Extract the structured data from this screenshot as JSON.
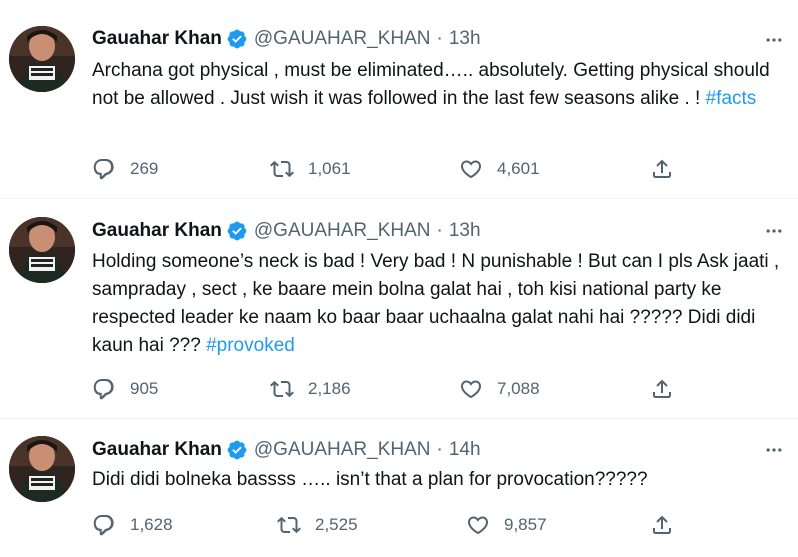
{
  "tweets": [
    {
      "author": "Gauahar Khan",
      "handle": "@GAUAHAR_KHAN",
      "separator": "·",
      "time": "13h",
      "text": "Archana got physical , must be eliminated….. absolutely. Getting physical should not be allowed . Just wish it was followed in the last few seasons alike . ! ",
      "hashtag": "#facts",
      "replies": "269",
      "retweets": "1,061",
      "likes": "4,601"
    },
    {
      "author": "Gauahar Khan",
      "handle": "@GAUAHAR_KHAN",
      "separator": "·",
      "time": "13h",
      "text": "Holding someone’s neck is bad ! Very bad ! N punishable !  But can I pls Ask jaati , sampraday , sect , ke baare mein bolna galat hai , toh kisi national party ke respected leader ke naam ko baar baar uchaalna galat nahi hai ????? Didi didi kaun hai ??? ",
      "hashtag": "#provoked",
      "replies": "905",
      "retweets": "2,186",
      "likes": "7,088"
    },
    {
      "author": "Gauahar Khan",
      "handle": "@GAUAHAR_KHAN",
      "separator": "·",
      "time": "14h",
      "text": "Didi didi bolneka bassss ….. isn’t that a plan for provocation?????",
      "hashtag": "",
      "replies": "1,628",
      "retweets": "2,525",
      "likes": "9,857"
    }
  ],
  "colors": {
    "text": "#0f1419",
    "secondary": "#536471",
    "link": "#1d9bf0",
    "verified": "#1d9bf0",
    "divider": "#eff3f4"
  },
  "icons": {
    "reply": "reply-icon",
    "retweet": "retweet-icon",
    "like": "like-icon",
    "share": "share-icon",
    "more": "more-icon",
    "verified": "verified-badge-icon"
  }
}
